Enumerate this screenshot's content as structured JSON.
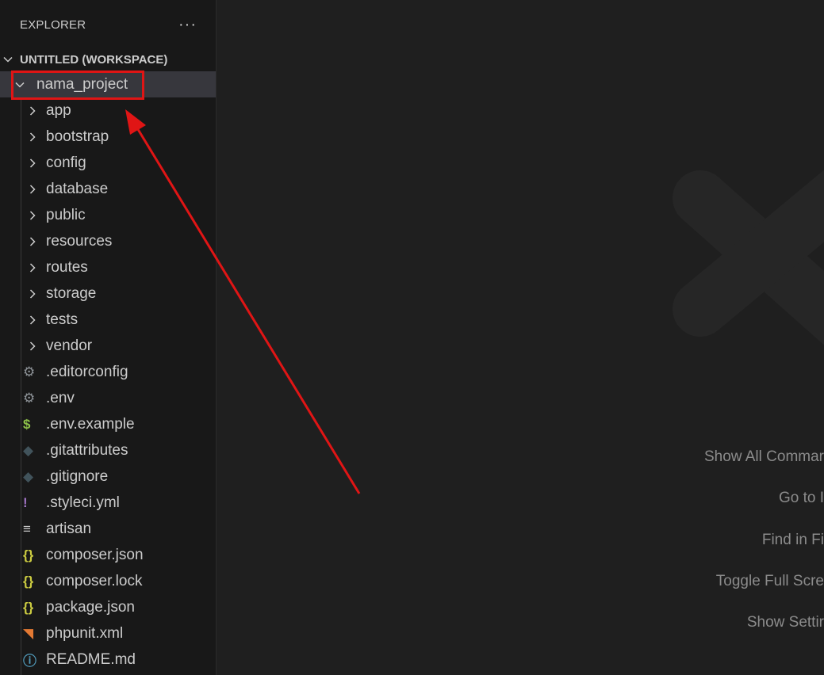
{
  "explorer": {
    "title": "EXPLORER",
    "more_label": "···",
    "workspace": "UNTITLED (WORKSPACE)",
    "project": "nama_project",
    "folders": [
      "app",
      "bootstrap",
      "config",
      "database",
      "public",
      "resources",
      "routes",
      "storage",
      "tests",
      "vendor"
    ],
    "files": [
      {
        "name": ".editorconfig",
        "icon": "gear-icon",
        "glyph": "⚙",
        "color": "#8c9196"
      },
      {
        "name": ".env",
        "icon": "gear-icon",
        "glyph": "⚙",
        "color": "#8c9196"
      },
      {
        "name": ".env.example",
        "icon": "dollar-icon",
        "glyph": "$",
        "color": "#8dc149"
      },
      {
        "name": ".gitattributes",
        "icon": "git-icon",
        "glyph": "◆",
        "color": "#41535b"
      },
      {
        "name": ".gitignore",
        "icon": "git-icon",
        "glyph": "◆",
        "color": "#41535b"
      },
      {
        "name": ".styleci.yml",
        "icon": "exclamation-icon",
        "glyph": "!",
        "color": "#a074c4"
      },
      {
        "name": "artisan",
        "icon": "lines-icon",
        "glyph": "≡",
        "color": "#cccccc"
      },
      {
        "name": "composer.json",
        "icon": "braces-icon",
        "glyph": "{}",
        "color": "#cbcb41"
      },
      {
        "name": "composer.lock",
        "icon": "braces-icon",
        "glyph": "{}",
        "color": "#cbcb41"
      },
      {
        "name": "package.json",
        "icon": "braces-icon",
        "glyph": "{}",
        "color": "#cbcb41"
      },
      {
        "name": "phpunit.xml",
        "icon": "rss-icon",
        "glyph": "◥",
        "color": "#e37933"
      },
      {
        "name": "README.md",
        "icon": "info-icon",
        "glyph": "ⓘ",
        "color": "#519aba"
      }
    ]
  },
  "editor": {
    "shortcuts": [
      "Show All Commar",
      "Go to I",
      "Find in Fi",
      "Toggle Full Scre",
      "Show Settir"
    ]
  },
  "colors": {
    "highlight": "#e01515",
    "arrow": "#e01515"
  }
}
